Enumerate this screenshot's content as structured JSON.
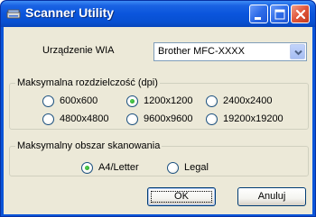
{
  "window": {
    "title": "Scanner Utility",
    "controls": [
      "minimize-icon",
      "maximize-icon",
      "close-icon"
    ]
  },
  "device": {
    "label": "Urządzenie WIA",
    "selected": "Brother MFC-XXXX"
  },
  "resolution": {
    "title": "Maksymalna rozdzielczość (dpi)",
    "options": [
      {
        "label": "600x600",
        "selected": false
      },
      {
        "label": "1200x1200",
        "selected": true
      },
      {
        "label": "2400x2400",
        "selected": false
      },
      {
        "label": "4800x4800",
        "selected": false
      },
      {
        "label": "9600x9600",
        "selected": false
      },
      {
        "label": "19200x19200",
        "selected": false
      }
    ]
  },
  "area": {
    "title": "Maksymalny obszar skanowania",
    "options": [
      {
        "label": "A4/Letter",
        "selected": true
      },
      {
        "label": "Legal",
        "selected": false
      }
    ]
  },
  "buttons": {
    "ok": "OK",
    "cancel": "Anuluj"
  },
  "colors": {
    "titlebar": "#0a55dc",
    "dialog_bg": "#ece9d8",
    "radio_selected": "#21a121"
  }
}
